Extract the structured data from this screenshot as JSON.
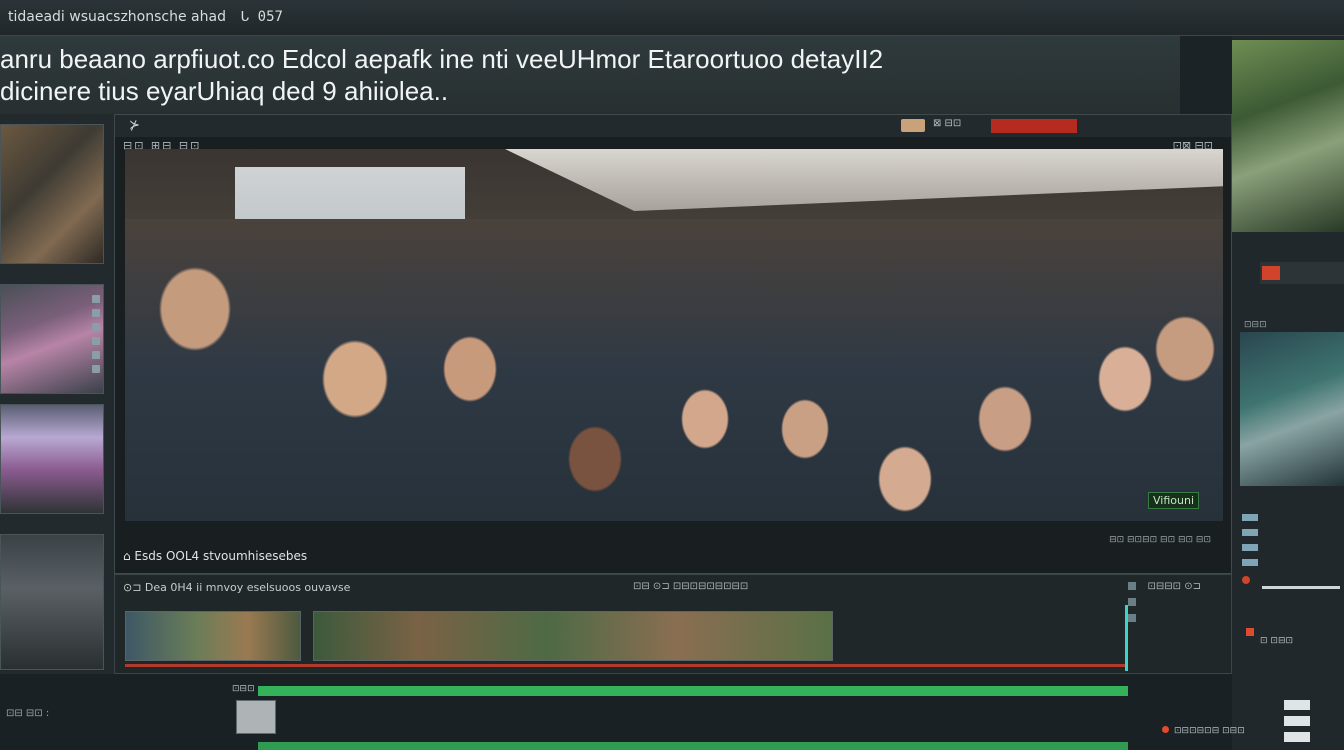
{
  "topbar": {
    "title": "tidaeadi wsuacszhonsche ahad",
    "symbol": "ᒐ 057"
  },
  "headline": {
    "line1": "anru beaano arpfiuot.co Edcol aepafk ine nti veeUHmor Etaroortuoo detayII2",
    "line2": "dicinere tius eyarUhiaq ded 9 ahiiolea.."
  },
  "viewer": {
    "logo": "⊁",
    "toolbar_left": "⊟⊡ ⊞⊟ ⊟⊡",
    "toolbar_right": "⊡⊠ ⊟⊡",
    "rec_meta": "⊠ ⊟⊡",
    "caption_badge": "Vifiouni",
    "caption_sub": "⊟⊡ ⊟⊡⊟⊡ ⊟⊡ ⊟⊡ ⊟⊡",
    "timecode_row": "⌂ Esds OOL4  stvoumhisesebes"
  },
  "timeline": {
    "header": "⊙⊐ Dea 0H4 ii mnvoy eselsuoos ouvavse",
    "mid": "⊡⊟ ⊙⊐ ⊡⊟⊡⊟⊡⊟⊡⊟⊡",
    "right": "⊡⊟⊟⊡ ⊙⊐"
  },
  "bottom": {
    "left_text": "⊡⊟ ⊟⊡ :",
    "time": "⊡⊟⊡",
    "rec_text": "⊡⊟⊡⊟⊡⊟ ⊡⊟⊡"
  },
  "right_col": {
    "label": "⊡⊟⊡",
    "bottom_text": "⊡ ⊡⊟⊡"
  },
  "colors": {
    "accent_red": "#d2432b",
    "accent_green": "#33b25a",
    "playhead": "#3bd6c8"
  }
}
